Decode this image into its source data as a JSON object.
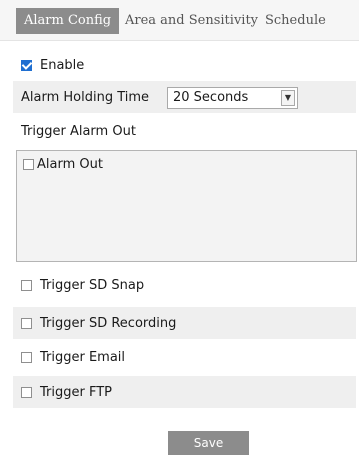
{
  "tabs": [
    {
      "label": "Alarm Config",
      "active": true
    },
    {
      "label": "Area and Sensitivity",
      "active": false
    },
    {
      "label": "Schedule",
      "active": false
    }
  ],
  "enable": {
    "label": "Enable",
    "checked": true
  },
  "alarm_holding_time": {
    "label": "Alarm Holding Time",
    "value": "20 Seconds"
  },
  "trigger_alarm_out": {
    "title": "Trigger Alarm Out",
    "items": [
      {
        "label": "Alarm Out",
        "checked": false
      }
    ]
  },
  "triggers": [
    {
      "label": "Trigger SD Snap",
      "checked": false
    },
    {
      "label": "Trigger SD Recording",
      "checked": false
    },
    {
      "label": "Trigger Email",
      "checked": false
    },
    {
      "label": "Trigger FTP",
      "checked": false
    }
  ],
  "save_label": "Save",
  "colors": {
    "active_tab": "#8c8c8c",
    "checkbox_checked": "#1f6fd1",
    "shaded_row": "#efefef"
  }
}
